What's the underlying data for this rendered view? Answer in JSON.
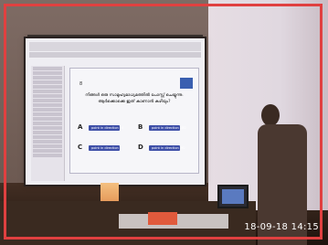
{
  "slide": {
    "question_number": "8",
    "question_text": "നിങ്ങൾ ഒരു സാമൂഹ്യമാധ്യമത്തിൽ പോസ്റ്റ് ചെയ്യുന്നു. ആർക്കൊക്കെ ഇത് കാണാൻ കഴിയും?",
    "options": [
      {
        "letter": "A",
        "button_text": "point in direction 90"
      },
      {
        "letter": "B",
        "button_text": "point in direction 180"
      },
      {
        "letter": "C",
        "button_text": "point in direction 0"
      },
      {
        "letter": "D",
        "button_text": "point in direction -90"
      }
    ]
  },
  "timestamp": "18-09-18 14:15",
  "colors": {
    "frame_border": "#e04040",
    "button": "#3e4fa8",
    "accent_box": "#e05a3c"
  }
}
